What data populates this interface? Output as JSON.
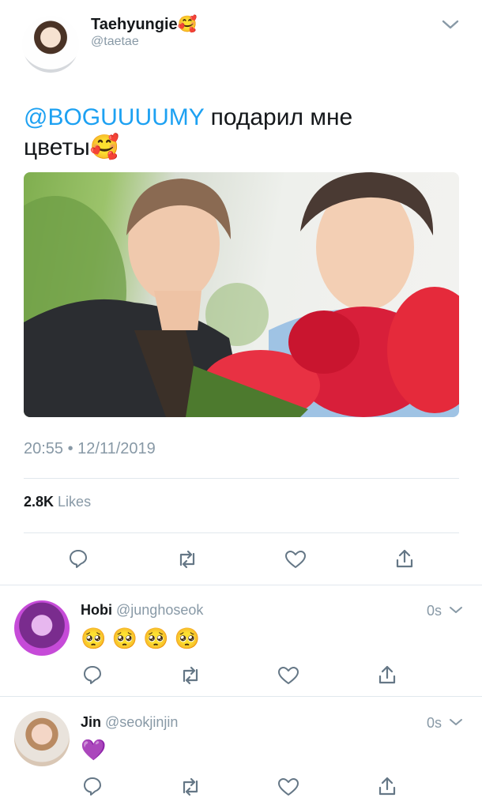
{
  "tweet": {
    "author": {
      "display_name": "Taehyungie",
      "name_emoji": "🥰",
      "handle": "@taetae"
    },
    "text": {
      "mention": "@BOGUUUUMY",
      "line1_rest": " подарил мне",
      "line2": "цветы",
      "line2_emoji": "🥰"
    },
    "timestamp": "20:55 • 12/11/2019",
    "likes": {
      "count": "2.8K",
      "label": "Likes"
    }
  },
  "replies": [
    {
      "display_name": "Hobi",
      "handle": "@junghoseok",
      "time": "0s",
      "text": "🥺 🥺 🥺 🥺"
    },
    {
      "display_name": "Jin",
      "handle": "@seokjinjin",
      "time": "0s",
      "text": "💜"
    }
  ],
  "actions": [
    "reply-icon",
    "retweet-icon",
    "like-icon",
    "share-icon"
  ],
  "colors": {
    "accent": "#1da1f2",
    "muted": "#8899a6",
    "divider": "#e1e8ed"
  }
}
